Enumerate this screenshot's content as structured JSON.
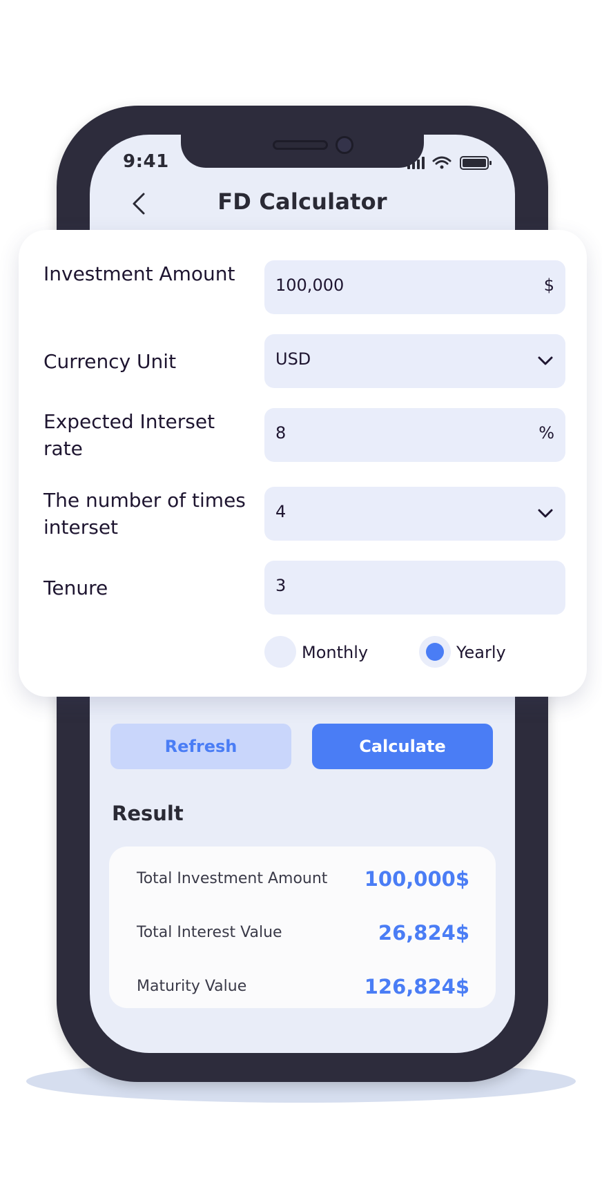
{
  "status_bar": {
    "time": "9:41",
    "icons": [
      "signal-icon",
      "wifi-icon",
      "battery-icon"
    ]
  },
  "header": {
    "title": "FD Calculator",
    "back_icon": "chevron-left-icon"
  },
  "form": {
    "investment": {
      "label": "Investment Amount",
      "value": "100,000",
      "unit": "$"
    },
    "currency": {
      "label": "Currency Unit",
      "value": "USD"
    },
    "interest_rate": {
      "label": "Expected Interset rate",
      "value": "8",
      "unit": "%"
    },
    "compounding": {
      "label": "The number of times interset",
      "value": "4"
    },
    "tenure": {
      "label": "Tenure",
      "value": "3"
    },
    "period_options": [
      {
        "label": "Monthly",
        "selected": false
      },
      {
        "label": "Yearly",
        "selected": true
      }
    ]
  },
  "actions": {
    "refresh": "Refresh",
    "calculate": "Calculate"
  },
  "result": {
    "title": "Result",
    "rows": [
      {
        "label": "Total Investment Amount",
        "value": "100,000$"
      },
      {
        "label": "Total Interest Value",
        "value": "26,824$"
      },
      {
        "label": "Maturity Value",
        "value": "126,824$"
      }
    ]
  },
  "colors": {
    "accent": "#4a7df5",
    "accent_light": "#c9d6fb",
    "screen_bg": "#e9edf8",
    "phone_frame": "#2d2c3c",
    "field_bg": "#e9edfa"
  }
}
